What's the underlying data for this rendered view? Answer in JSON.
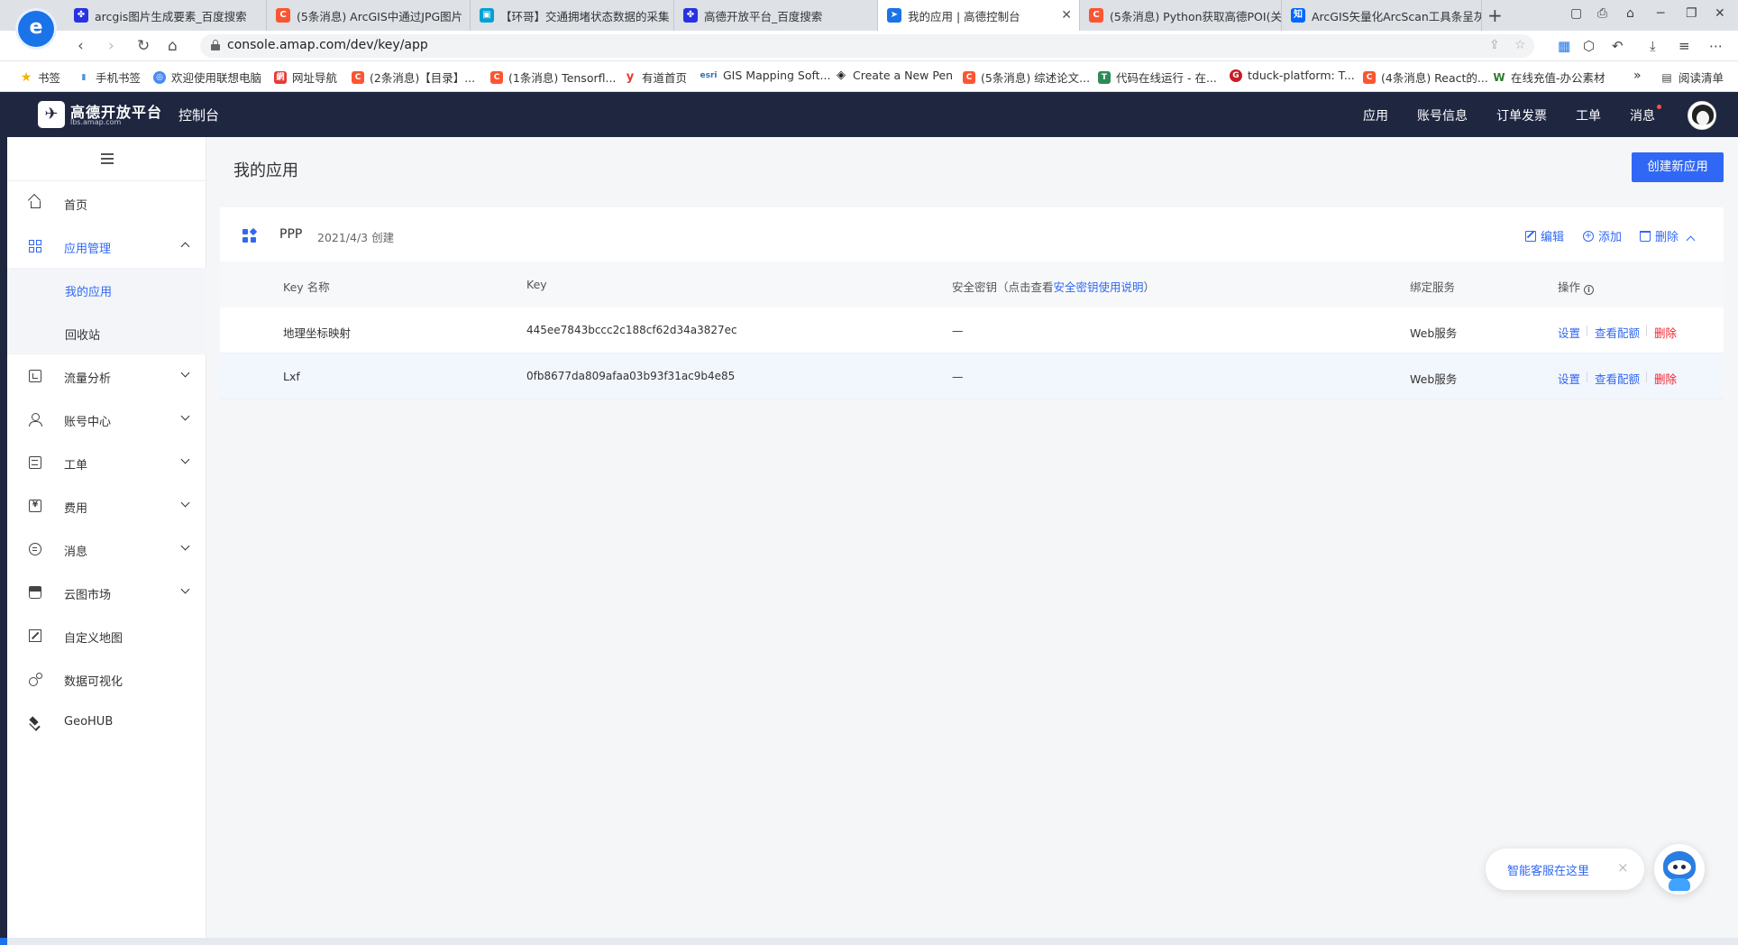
{
  "browser": {
    "tabs": [
      {
        "title": "arcgis图片生成要素_百度搜索",
        "favicon": "baidu-paw-icon",
        "color": "#2932e1"
      },
      {
        "title": "(5条消息) ArcGIS中通过JPG图片",
        "favicon": "csdn-c-icon",
        "color": "#fc5531"
      },
      {
        "title": "【环哥】交通拥堵状态数据的采集",
        "favicon": "bilibili-tv-icon",
        "color": "#00a1d6"
      },
      {
        "title": "高德开放平台_百度搜索",
        "favicon": "baidu-paw-icon",
        "color": "#2932e1"
      },
      {
        "title": "我的应用 | 高德控制台",
        "favicon": "amap-arrow-icon",
        "color": "#1a73e8"
      },
      {
        "title": "(5条消息) Python获取高德POI(关",
        "favicon": "csdn-c-icon",
        "color": "#fc5531"
      },
      {
        "title": "ArcGIS矢量化ArcScan工具条呈灰",
        "favicon": "zhihu-icon",
        "color": "#0066ff"
      }
    ],
    "url": "console.amap.com/dev/key/app",
    "logo_letter": "e",
    "bookmarks": [
      {
        "label": "书签",
        "favicon": "star-icon",
        "color": "#f5b400",
        "mark": "★"
      },
      {
        "label": "手机书签",
        "favicon": "mobile-bookmark-icon",
        "color": "#4a90e2",
        "mark": "▮"
      },
      {
        "label": "欢迎使用联想电脑",
        "favicon": "lenovo-icon",
        "color": "#4a8af4",
        "mark": "◎"
      },
      {
        "label": "网址导航",
        "favicon": "nav-icon",
        "color": "#e53935",
        "mark": "網"
      },
      {
        "label": "(2条消息)【目录】...",
        "favicon": "csdn-c-icon",
        "color": "#fc5531",
        "mark": "C"
      },
      {
        "label": "(1条消息) Tensorfl...",
        "favicon": "csdn-c-icon",
        "color": "#fc5531",
        "mark": "C"
      },
      {
        "label": "有道首页",
        "favicon": "youdao-icon",
        "color": "#e53935",
        "mark": "y"
      },
      {
        "label": "GIS Mapping Soft...",
        "favicon": "esri-icon",
        "color": "#2f6fb3",
        "mark": "esri"
      },
      {
        "label": "Create a New Pen",
        "favicon": "codepen-icon",
        "color": "#222222",
        "mark": "◈"
      },
      {
        "label": "(5条消息) 综述论文...",
        "favicon": "csdn-c-icon",
        "color": "#fc5531",
        "mark": "C"
      },
      {
        "label": "代码在线运行 - 在...",
        "favicon": "tool-t-icon",
        "color": "#2e8b57",
        "mark": "T"
      },
      {
        "label": "tduck-platform: T...",
        "favicon": "gitee-icon",
        "color": "#c71d23",
        "mark": "G"
      },
      {
        "label": "(4条消息) React的...",
        "favicon": "csdn-c-icon",
        "color": "#fc5531",
        "mark": "C"
      },
      {
        "label": "在线充值-办公素材",
        "favicon": "w-icon",
        "color": "#2e7d32",
        "mark": "W"
      }
    ],
    "more_bookmarks": "»",
    "reading_list": "阅读清单"
  },
  "header": {
    "brand_name": "高德开放平台",
    "brand_sub": "lbs.amap.com",
    "console_title": "控制台",
    "nav": [
      "应用",
      "账号信息",
      "订单发票",
      "工单",
      "消息"
    ]
  },
  "sidebar": {
    "items": [
      {
        "label": "首页",
        "icon": "home-icon"
      },
      {
        "label": "应用管理",
        "icon": "grid-icon"
      },
      {
        "label": "我的应用",
        "icon": ""
      },
      {
        "label": "回收站",
        "icon": ""
      },
      {
        "label": "流量分析",
        "icon": "chart-box-icon"
      },
      {
        "label": "账号中心",
        "icon": "user-icon"
      },
      {
        "label": "工单",
        "icon": "ticket-icon"
      },
      {
        "label": "费用",
        "icon": "fee-icon"
      },
      {
        "label": "消息",
        "icon": "message-icon"
      },
      {
        "label": "云图市场",
        "icon": "store-icon"
      },
      {
        "label": "自定义地图",
        "icon": "custom-map-icon"
      },
      {
        "label": "数据可视化",
        "icon": "data-vis-icon"
      },
      {
        "label": "GeoHUB",
        "icon": "layers-icon"
      }
    ]
  },
  "main": {
    "page_title": "我的应用",
    "create_button": "创建新应用",
    "app": {
      "name": "PPP",
      "created": "2021/4/3 创建",
      "actions": {
        "edit": "编辑",
        "add": "添加",
        "delete": "删除"
      }
    },
    "table": {
      "headers": {
        "key_name": "Key 名称",
        "key": "Key",
        "secret_prefix": "安全密钥（点击查看",
        "secret_link": "安全密钥使用说明",
        "secret_suffix": "）",
        "service": "绑定服务",
        "ops": "操作"
      },
      "rows": [
        {
          "name": "地理坐标映射",
          "key": "445ee7843bccc2c188cf62d34a3827ec",
          "secret": "—",
          "service": "Web服务",
          "op_settings": "设置",
          "op_quota": "查看配额",
          "op_delete": "删除"
        },
        {
          "name": "Lxf",
          "key": "0fb8677da809afaa03b93f31ac9b4e85",
          "secret": "—",
          "service": "Web服务",
          "op_settings": "设置",
          "op_quota": "查看配额",
          "op_delete": "删除"
        }
      ]
    }
  },
  "assistant": {
    "label": "智能客服在这里",
    "close": "×"
  },
  "colors": {
    "accent": "#3068f5",
    "header_bg": "#1f2640",
    "danger": "#f5222d"
  }
}
